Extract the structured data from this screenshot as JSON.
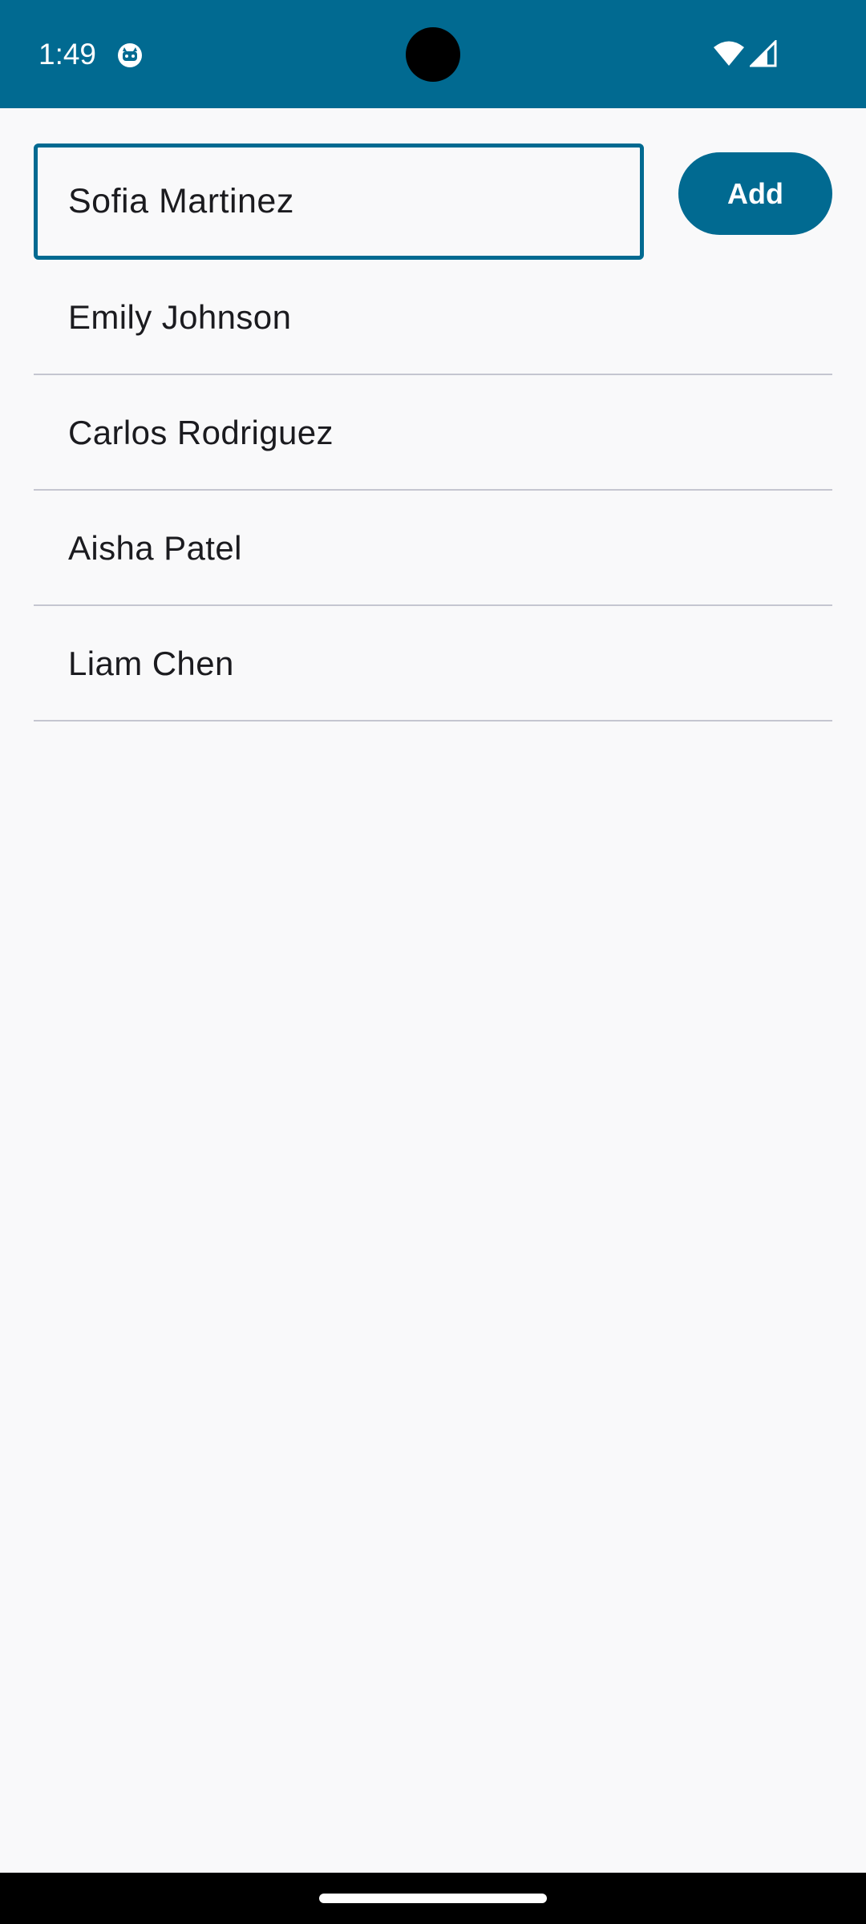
{
  "status_bar": {
    "time": "1:49",
    "background": "#016a91",
    "icons": [
      "app-notification-icon",
      "wifi-icon",
      "cellular-signal-icon"
    ]
  },
  "form": {
    "input_value": "Sofia Martinez",
    "add_label": "Add",
    "accent": "#016a91"
  },
  "names": [
    {
      "label": "Emily Johnson"
    },
    {
      "label": "Carlos Rodriguez"
    },
    {
      "label": "Aisha Patel"
    },
    {
      "label": "Liam Chen"
    }
  ]
}
